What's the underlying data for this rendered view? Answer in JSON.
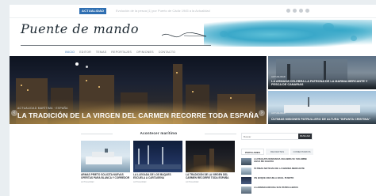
{
  "topbar": {
    "badge": "ACTUALIDAD",
    "ticker": "Evolución de la pesca (1) por Puerto de Cádiz 1945 a la Actualidad",
    "social_icons": [
      "facebook-icon",
      "twitter-icon",
      "google-plus-icon",
      "rss-icon"
    ]
  },
  "header": {
    "logo": "Puente de mando",
    "accent_color": "#3aa8c9"
  },
  "nav": {
    "items": [
      "INICIO",
      "EDITOR",
      "TEMAS",
      "REPORTAJES",
      "OPINIONES",
      "CONTACTO"
    ]
  },
  "hero": {
    "category": "ACTUALIDAD MARÍTIMA · ESPAÑA",
    "title": "LA TRADICIÓN DE LA VIRGEN DEL CARMEN RECORRE TODA ESPAÑA"
  },
  "side": [
    {
      "category": "ACTUALIDAD",
      "title": "LA ARMADA CELEBRA LA PATRONA DE LA MARINA MERCANTE Y PESCA DE CANARIAS"
    },
    {
      "category": "ACTUALIDAD",
      "title": "ÚLTIMAS MISIONES PATRULLERO DE ALTURA \"INFANTA CRISTINA\""
    }
  ],
  "section": {
    "title": "Acontecer marítimo",
    "cards": [
      {
        "title": "ARMAS PRIETO SOLICITA NUEVAS OFERTAS PARA BLANCA Y CORREDOR",
        "meta": "ACTUALIDAD"
      },
      {
        "title": "LA LLEGADA DE LOS BUQUES ESCUELA A CARTAGENA",
        "meta": "ACTUALIDAD"
      },
      {
        "title": "LA TRADICIÓN DE LA VIRGEN DEL CARMEN RECORRE TODA ESPAÑA",
        "meta": "ACTUALIDAD"
      }
    ]
  },
  "sidebar": {
    "search_placeholder": "Buscar",
    "search_button": "BUSCAR",
    "tabs": [
      "POPULARES",
      "RECIENTES",
      "COMENTARIOS"
    ],
    "list": [
      "LA FRAGATA NUMANCIA CELEBRA SU SOLEMNE AGUA DE GALICIA",
      "ÚLTIMAS NOTICIAS DE LA MARINA MERCANTE",
      "UN BUQUE ESCUELA EN EL PUERTO",
      "LA ARMADA REVISA SUS PATRULLEROS"
    ]
  }
}
